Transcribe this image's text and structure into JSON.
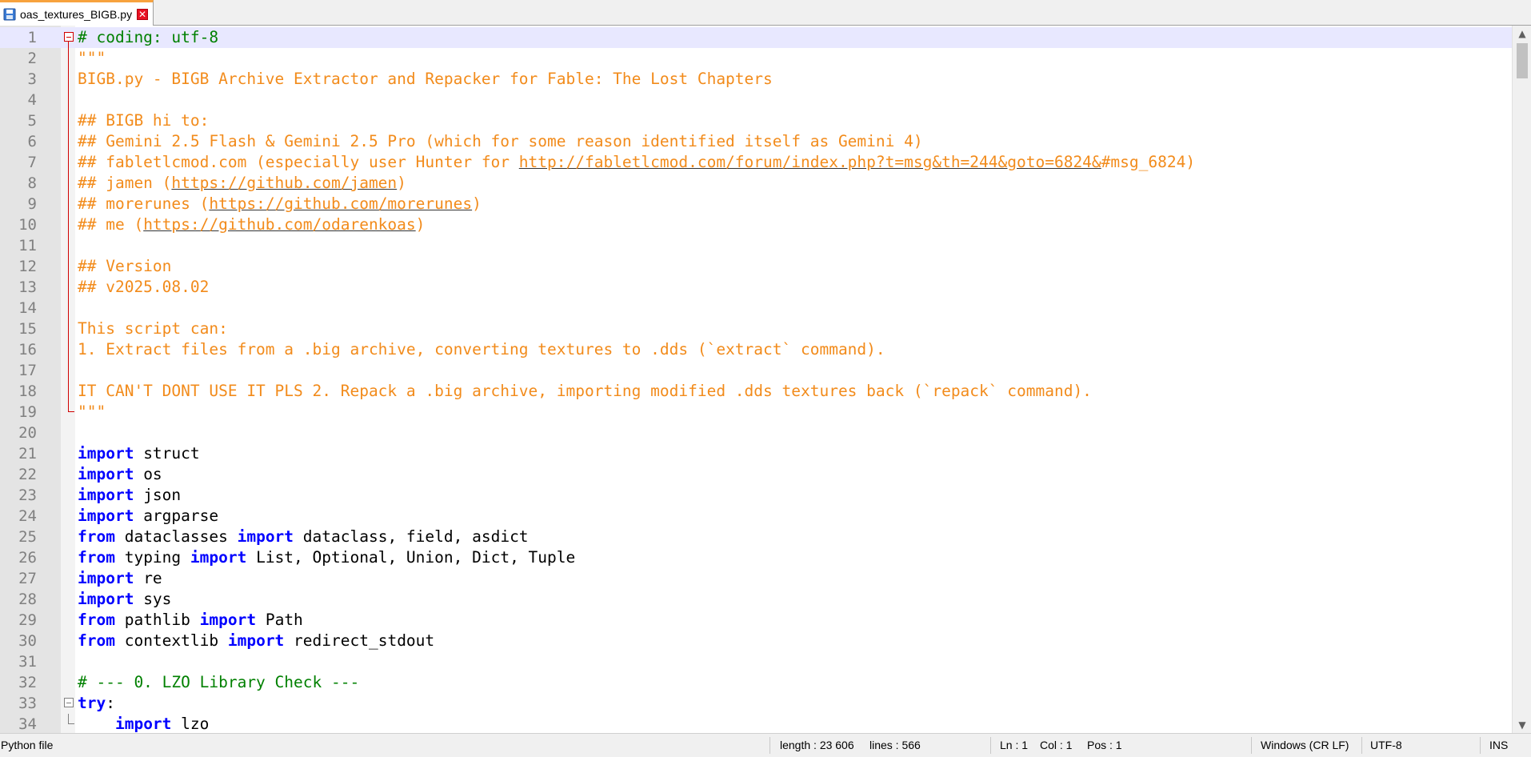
{
  "tab": {
    "filename": "oas_textures_BIGB.py",
    "icon": "save-icon"
  },
  "editor": {
    "lines": [
      {
        "n": "1",
        "tokens": [
          {
            "t": "# coding: utf-8",
            "c": "comment"
          }
        ]
      },
      {
        "n": "2",
        "tokens": [
          {
            "t": "\"\"\"",
            "c": "string"
          }
        ]
      },
      {
        "n": "3",
        "tokens": [
          {
            "t": "BIGB.py - BIGB Archive Extractor and Repacker for Fable: The Lost Chapters",
            "c": "string"
          }
        ]
      },
      {
        "n": "4",
        "tokens": []
      },
      {
        "n": "5",
        "tokens": [
          {
            "t": "## BIGB hi to:",
            "c": "string"
          }
        ]
      },
      {
        "n": "6",
        "tokens": [
          {
            "t": "## Gemini 2.5 Flash & Gemini 2.5 Pro (which for some reason identified itself as Gemini 4)",
            "c": "string"
          }
        ]
      },
      {
        "n": "7",
        "tokens": [
          {
            "t": "## fabletlcmod.com (especially user Hunter for ",
            "c": "string"
          },
          {
            "t": "http://fabletlcmod.com/forum/index.php?t=msg&th=244&goto=6824&",
            "c": "url"
          },
          {
            "t": "#msg_6824)",
            "c": "string"
          }
        ]
      },
      {
        "n": "8",
        "tokens": [
          {
            "t": "## jamen (",
            "c": "string"
          },
          {
            "t": "https://github.com/jamen",
            "c": "url"
          },
          {
            "t": ")",
            "c": "string"
          }
        ]
      },
      {
        "n": "9",
        "tokens": [
          {
            "t": "## morerunes (",
            "c": "string"
          },
          {
            "t": "https://github.com/morerunes",
            "c": "url"
          },
          {
            "t": ")",
            "c": "string"
          }
        ]
      },
      {
        "n": "10",
        "tokens": [
          {
            "t": "## me (",
            "c": "string"
          },
          {
            "t": "https://github.com/odarenkoas",
            "c": "url"
          },
          {
            "t": ")",
            "c": "string"
          }
        ]
      },
      {
        "n": "11",
        "tokens": []
      },
      {
        "n": "12",
        "tokens": [
          {
            "t": "## Version",
            "c": "string"
          }
        ]
      },
      {
        "n": "13",
        "tokens": [
          {
            "t": "## v2025.08.02",
            "c": "string"
          }
        ]
      },
      {
        "n": "14",
        "tokens": []
      },
      {
        "n": "15",
        "tokens": [
          {
            "t": "This script can:",
            "c": "string"
          }
        ]
      },
      {
        "n": "16",
        "tokens": [
          {
            "t": "1. Extract files from a .big archive, converting textures to .dds (`extract` command).",
            "c": "string"
          }
        ]
      },
      {
        "n": "17",
        "tokens": []
      },
      {
        "n": "18",
        "tokens": [
          {
            "t": "IT CAN'T DONT USE IT PLS 2. Repack a .big archive, importing modified .dds textures back (`repack` command).",
            "c": "string"
          }
        ]
      },
      {
        "n": "19",
        "tokens": [
          {
            "t": "\"\"\"",
            "c": "string"
          }
        ]
      },
      {
        "n": "20",
        "tokens": []
      },
      {
        "n": "21",
        "tokens": [
          {
            "t": "import",
            "c": "kw"
          },
          {
            "t": " struct",
            "c": "plain"
          }
        ]
      },
      {
        "n": "22",
        "tokens": [
          {
            "t": "import",
            "c": "kw"
          },
          {
            "t": " os",
            "c": "plain"
          }
        ]
      },
      {
        "n": "23",
        "tokens": [
          {
            "t": "import",
            "c": "kw"
          },
          {
            "t": " json",
            "c": "plain"
          }
        ]
      },
      {
        "n": "24",
        "tokens": [
          {
            "t": "import",
            "c": "kw"
          },
          {
            "t": " argparse",
            "c": "plain"
          }
        ]
      },
      {
        "n": "25",
        "tokens": [
          {
            "t": "from",
            "c": "kw"
          },
          {
            "t": " dataclasses ",
            "c": "plain"
          },
          {
            "t": "import",
            "c": "kw"
          },
          {
            "t": " dataclass, field, asdict",
            "c": "plain"
          }
        ]
      },
      {
        "n": "26",
        "tokens": [
          {
            "t": "from",
            "c": "kw"
          },
          {
            "t": " typing ",
            "c": "plain"
          },
          {
            "t": "import",
            "c": "kw"
          },
          {
            "t": " List, Optional, Union, Dict, Tuple",
            "c": "plain"
          }
        ]
      },
      {
        "n": "27",
        "tokens": [
          {
            "t": "import",
            "c": "kw"
          },
          {
            "t": " re",
            "c": "plain"
          }
        ]
      },
      {
        "n": "28",
        "tokens": [
          {
            "t": "import",
            "c": "kw"
          },
          {
            "t": " sys",
            "c": "plain"
          }
        ]
      },
      {
        "n": "29",
        "tokens": [
          {
            "t": "from",
            "c": "kw"
          },
          {
            "t": " pathlib ",
            "c": "plain"
          },
          {
            "t": "import",
            "c": "kw"
          },
          {
            "t": " Path",
            "c": "plain"
          }
        ]
      },
      {
        "n": "30",
        "tokens": [
          {
            "t": "from",
            "c": "kw"
          },
          {
            "t": " contextlib ",
            "c": "plain"
          },
          {
            "t": "import",
            "c": "kw"
          },
          {
            "t": " redirect_stdout",
            "c": "plain"
          }
        ]
      },
      {
        "n": "31",
        "tokens": []
      },
      {
        "n": "32",
        "tokens": [
          {
            "t": "# --- 0. LZO Library Check ---",
            "c": "comment"
          }
        ]
      },
      {
        "n": "33",
        "tokens": [
          {
            "t": "try",
            "c": "kw"
          },
          {
            "t": ":",
            "c": "plain"
          }
        ]
      },
      {
        "n": "34",
        "tokens": [
          {
            "t": "    ",
            "c": "plain"
          },
          {
            "t": "import",
            "c": "kw"
          },
          {
            "t": " lzo",
            "c": "plain"
          }
        ]
      }
    ]
  },
  "status": {
    "file_type": "Python file",
    "length": "length : 23 606",
    "lines": "lines : 566",
    "ln": "Ln : 1",
    "col": "Col : 1",
    "pos": "Pos : 1",
    "eol": "Windows (CR LF)",
    "encoding": "UTF-8",
    "mode": "INS"
  }
}
